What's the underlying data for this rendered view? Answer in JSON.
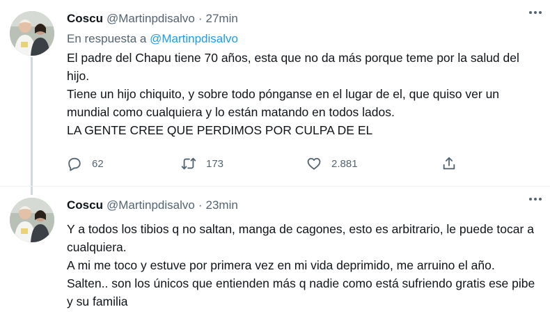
{
  "tweets": [
    {
      "display_name": "Coscu",
      "handle": "@Martinpdisalvo",
      "separator": "·",
      "time": "27min",
      "reply_prefix": "En respuesta a",
      "reply_handle": "@Martinpdisalvo",
      "lines": [
        "El padre del Chapu tiene 70 años, esta que no da más porque teme por la salud del hijo.",
        "Tiene un hijo chiquito, y sobre todo pónganse en el lugar de el, que quiso ver un mundial como cualquiera y lo están matando en todos lados.",
        "LA GENTE CREE QUE PERDIMOS POR CULPA DE EL"
      ],
      "actions": {
        "replies": "62",
        "retweets": "173",
        "likes": "2.881"
      }
    },
    {
      "display_name": "Coscu",
      "handle": "@Martinpdisalvo",
      "separator": "·",
      "time": "23min",
      "lines": [
        "Y a todos los tibios q no saltan, manga de cagones, esto es arbitrario, le puede tocar a cualquiera.",
        "A mi me toco y estuve por primera vez en mi vida deprimido, me arruino el año.",
        "Salten.. son los únicos que entienden más q nadie como está sufriendo gratis ese pibe y su familia"
      ]
    }
  ],
  "colors": {
    "link": "#1d9bf0",
    "secondary": "#536471",
    "text": "#0f1419",
    "thread_line": "#cfd9de"
  },
  "icons": {
    "reply": "speech-bubble-icon",
    "retweet": "retweet-arrows-icon",
    "like": "heart-icon",
    "share": "share-upload-icon",
    "more": "three-dots-icon"
  }
}
